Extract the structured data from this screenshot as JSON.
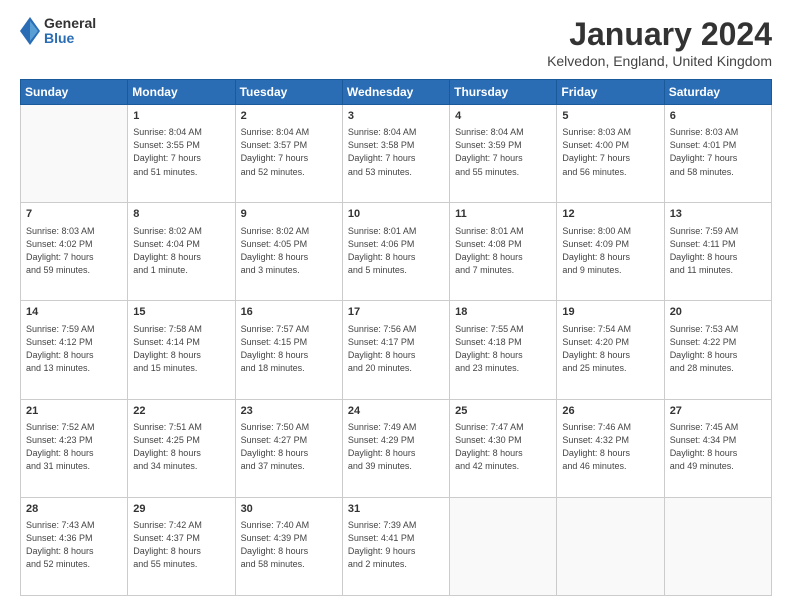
{
  "header": {
    "logo_general": "General",
    "logo_blue": "Blue",
    "month_title": "January 2024",
    "location": "Kelvedon, England, United Kingdom"
  },
  "days_of_week": [
    "Sunday",
    "Monday",
    "Tuesday",
    "Wednesday",
    "Thursday",
    "Friday",
    "Saturday"
  ],
  "weeks": [
    [
      {
        "day": "",
        "content": ""
      },
      {
        "day": "1",
        "content": "Sunrise: 8:04 AM\nSunset: 3:55 PM\nDaylight: 7 hours\nand 51 minutes."
      },
      {
        "day": "2",
        "content": "Sunrise: 8:04 AM\nSunset: 3:57 PM\nDaylight: 7 hours\nand 52 minutes."
      },
      {
        "day": "3",
        "content": "Sunrise: 8:04 AM\nSunset: 3:58 PM\nDaylight: 7 hours\nand 53 minutes."
      },
      {
        "day": "4",
        "content": "Sunrise: 8:04 AM\nSunset: 3:59 PM\nDaylight: 7 hours\nand 55 minutes."
      },
      {
        "day": "5",
        "content": "Sunrise: 8:03 AM\nSunset: 4:00 PM\nDaylight: 7 hours\nand 56 minutes."
      },
      {
        "day": "6",
        "content": "Sunrise: 8:03 AM\nSunset: 4:01 PM\nDaylight: 7 hours\nand 58 minutes."
      }
    ],
    [
      {
        "day": "7",
        "content": "Sunrise: 8:03 AM\nSunset: 4:02 PM\nDaylight: 7 hours\nand 59 minutes."
      },
      {
        "day": "8",
        "content": "Sunrise: 8:02 AM\nSunset: 4:04 PM\nDaylight: 8 hours\nand 1 minute."
      },
      {
        "day": "9",
        "content": "Sunrise: 8:02 AM\nSunset: 4:05 PM\nDaylight: 8 hours\nand 3 minutes."
      },
      {
        "day": "10",
        "content": "Sunrise: 8:01 AM\nSunset: 4:06 PM\nDaylight: 8 hours\nand 5 minutes."
      },
      {
        "day": "11",
        "content": "Sunrise: 8:01 AM\nSunset: 4:08 PM\nDaylight: 8 hours\nand 7 minutes."
      },
      {
        "day": "12",
        "content": "Sunrise: 8:00 AM\nSunset: 4:09 PM\nDaylight: 8 hours\nand 9 minutes."
      },
      {
        "day": "13",
        "content": "Sunrise: 7:59 AM\nSunset: 4:11 PM\nDaylight: 8 hours\nand 11 minutes."
      }
    ],
    [
      {
        "day": "14",
        "content": "Sunrise: 7:59 AM\nSunset: 4:12 PM\nDaylight: 8 hours\nand 13 minutes."
      },
      {
        "day": "15",
        "content": "Sunrise: 7:58 AM\nSunset: 4:14 PM\nDaylight: 8 hours\nand 15 minutes."
      },
      {
        "day": "16",
        "content": "Sunrise: 7:57 AM\nSunset: 4:15 PM\nDaylight: 8 hours\nand 18 minutes."
      },
      {
        "day": "17",
        "content": "Sunrise: 7:56 AM\nSunset: 4:17 PM\nDaylight: 8 hours\nand 20 minutes."
      },
      {
        "day": "18",
        "content": "Sunrise: 7:55 AM\nSunset: 4:18 PM\nDaylight: 8 hours\nand 23 minutes."
      },
      {
        "day": "19",
        "content": "Sunrise: 7:54 AM\nSunset: 4:20 PM\nDaylight: 8 hours\nand 25 minutes."
      },
      {
        "day": "20",
        "content": "Sunrise: 7:53 AM\nSunset: 4:22 PM\nDaylight: 8 hours\nand 28 minutes."
      }
    ],
    [
      {
        "day": "21",
        "content": "Sunrise: 7:52 AM\nSunset: 4:23 PM\nDaylight: 8 hours\nand 31 minutes."
      },
      {
        "day": "22",
        "content": "Sunrise: 7:51 AM\nSunset: 4:25 PM\nDaylight: 8 hours\nand 34 minutes."
      },
      {
        "day": "23",
        "content": "Sunrise: 7:50 AM\nSunset: 4:27 PM\nDaylight: 8 hours\nand 37 minutes."
      },
      {
        "day": "24",
        "content": "Sunrise: 7:49 AM\nSunset: 4:29 PM\nDaylight: 8 hours\nand 39 minutes."
      },
      {
        "day": "25",
        "content": "Sunrise: 7:47 AM\nSunset: 4:30 PM\nDaylight: 8 hours\nand 42 minutes."
      },
      {
        "day": "26",
        "content": "Sunrise: 7:46 AM\nSunset: 4:32 PM\nDaylight: 8 hours\nand 46 minutes."
      },
      {
        "day": "27",
        "content": "Sunrise: 7:45 AM\nSunset: 4:34 PM\nDaylight: 8 hours\nand 49 minutes."
      }
    ],
    [
      {
        "day": "28",
        "content": "Sunrise: 7:43 AM\nSunset: 4:36 PM\nDaylight: 8 hours\nand 52 minutes."
      },
      {
        "day": "29",
        "content": "Sunrise: 7:42 AM\nSunset: 4:37 PM\nDaylight: 8 hours\nand 55 minutes."
      },
      {
        "day": "30",
        "content": "Sunrise: 7:40 AM\nSunset: 4:39 PM\nDaylight: 8 hours\nand 58 minutes."
      },
      {
        "day": "31",
        "content": "Sunrise: 7:39 AM\nSunset: 4:41 PM\nDaylight: 9 hours\nand 2 minutes."
      },
      {
        "day": "",
        "content": ""
      },
      {
        "day": "",
        "content": ""
      },
      {
        "day": "",
        "content": ""
      }
    ]
  ]
}
